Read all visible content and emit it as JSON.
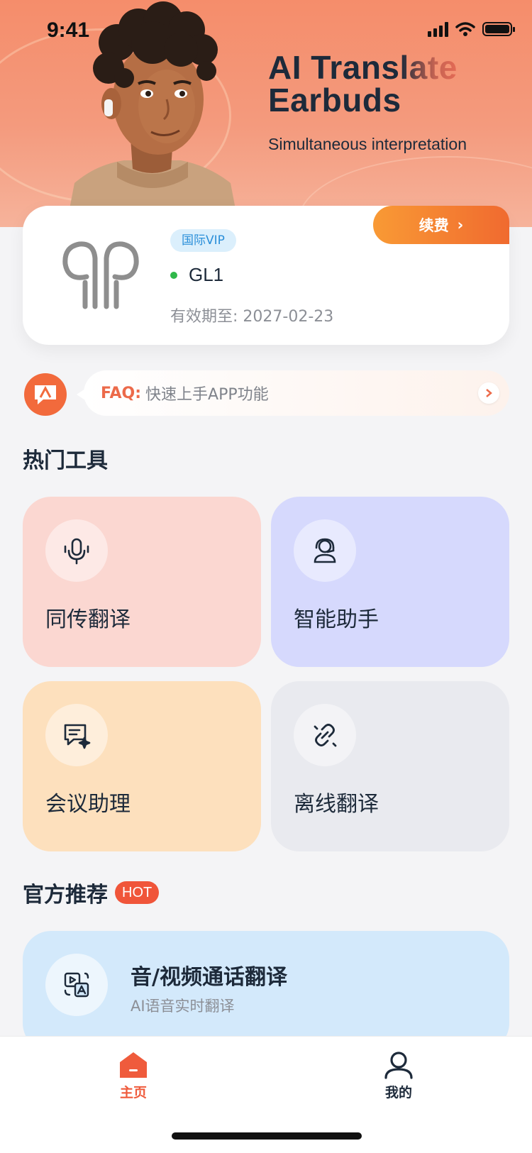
{
  "status_bar": {
    "time": "9:41"
  },
  "hero": {
    "title_line1_a": "AI Trans",
    "title_line1_b": "late",
    "title_line2": "Earbuds",
    "subtitle": "Simultaneous interpretation"
  },
  "device": {
    "badge": "国际VIP",
    "name": "GL1",
    "status_color": "#2fb84a",
    "expiry": "有效期至: 2027-02-23",
    "renew_label": "续费",
    "icon": "earbuds-icon"
  },
  "faq": {
    "label": "FAQ:",
    "text": "快速上手APP功能"
  },
  "tools_section": {
    "title": "热门工具",
    "items": [
      {
        "label": "同传翻译",
        "icon": "microphone-icon",
        "color": "#fbd7d1"
      },
      {
        "label": "智能助手",
        "icon": "assistant-icon",
        "color": "#d6d9fd"
      },
      {
        "label": "会议助理",
        "icon": "chat-sparkle-icon",
        "color": "#fde0bd"
      },
      {
        "label": "离线翻译",
        "icon": "link-broken-icon",
        "color": "#e9eaef"
      }
    ]
  },
  "recommend_section": {
    "title": "官方推荐",
    "hot_badge": "HOT",
    "promo": {
      "title": "音/视频通话翻译",
      "subtitle": "AI语音实时翻译",
      "icon": "video-translate-icon"
    }
  },
  "tabbar": {
    "items": [
      {
        "label": "主页",
        "icon": "home-icon",
        "active": true
      },
      {
        "label": "我的",
        "icon": "user-icon",
        "active": false
      }
    ],
    "accent": "#ef5b3c"
  }
}
